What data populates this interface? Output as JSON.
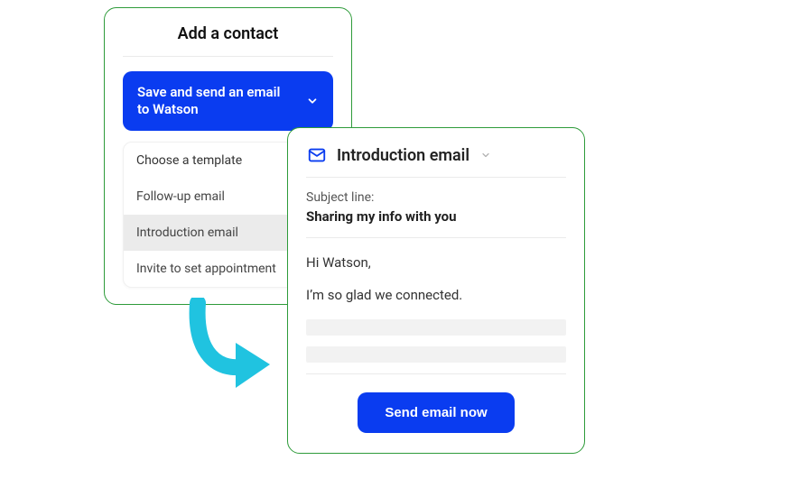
{
  "left_panel": {
    "title": "Add a contact",
    "primary_button_label": "Save and send an email to Watson",
    "dropdown_header": "Choose a template",
    "template_options": [
      "Follow-up email",
      "Introduction email",
      "Invite to set appointment"
    ],
    "hovered_option_index": 1
  },
  "right_panel": {
    "template_title": "Introduction email",
    "subject_label": "Subject line:",
    "subject_value": "Sharing my info with you",
    "body_line_1": "Hi Watson,",
    "body_line_2": "I’m so glad we connected.",
    "send_button_label": "Send email now"
  },
  "colors": {
    "primary": "#0a3cf0",
    "panel_border": "#2e9b3a",
    "arrow": "#20c3e0"
  }
}
